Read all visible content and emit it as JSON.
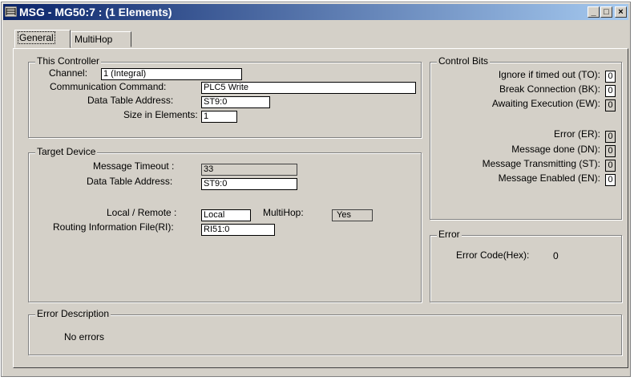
{
  "window": {
    "title": "MSG - MG50:7 : (1 Elements)",
    "buttons": {
      "minimize": "_",
      "maximize": "□",
      "close": "×"
    }
  },
  "tabs": [
    {
      "label": "General",
      "active": true
    },
    {
      "label": "MultiHop",
      "active": false
    }
  ],
  "this_controller": {
    "legend": "This Controller",
    "channel_label": "Channel:",
    "channel_value": "1 (Integral)",
    "comm_label": "Communication Command:",
    "comm_value": "PLC5 Write",
    "dta_label": "Data Table Address:",
    "dta_value": "ST9:0",
    "size_label": "Size in Elements:",
    "size_value": "1"
  },
  "target_device": {
    "legend": "Target Device",
    "timeout_label": "Message Timeout :",
    "timeout_value": "33",
    "dta_label": "Data Table Address:",
    "dta_value": "ST9:0",
    "local_remote_label": "Local / Remote :",
    "local_remote_value": "Local",
    "multihop_label": "MultiHop:",
    "multihop_value": "Yes",
    "routing_label": "Routing Information File(RI):",
    "routing_value": "RI51:0"
  },
  "control_bits": {
    "legend": "Control Bits",
    "items": [
      {
        "label": "Ignore if timed out (TO):",
        "value": "0"
      },
      {
        "label": "Break Connection (BK):",
        "value": "0"
      },
      {
        "label": "Awaiting Execution (EW):",
        "value": "0"
      },
      {
        "label": "Error (ER):",
        "value": "0"
      },
      {
        "label": "Message done (DN):",
        "value": "0"
      },
      {
        "label": "Message Transmitting (ST):",
        "value": "0"
      },
      {
        "label": "Message Enabled (EN):",
        "value": "0"
      }
    ]
  },
  "error": {
    "legend": "Error",
    "code_label": "Error Code(Hex):",
    "code_value": "0"
  },
  "error_description": {
    "legend": "Error Description",
    "text": "No errors"
  }
}
